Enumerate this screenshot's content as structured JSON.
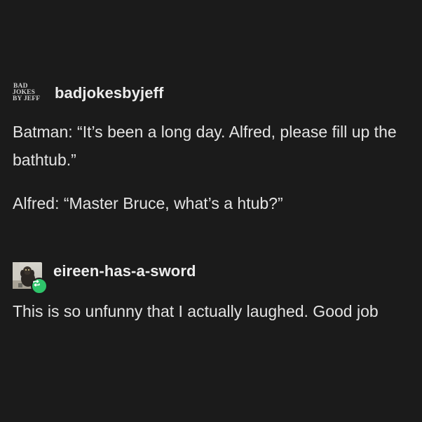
{
  "op": {
    "avatar_logo_lines": [
      "BAD",
      "JOKES",
      "BY JEFF"
    ],
    "username": "badjokesbyjeff",
    "paragraphs": [
      "Batman: “It’s been a long day. Alfred, please fill up the bathtub.”",
      "Alfred: “Master Bruce, what’s a htub?”"
    ]
  },
  "reblog": {
    "avatar_icon": "dog-photo-avatar",
    "badge_icon": "reblog-icon",
    "badge_color": "#2ec46a",
    "username": "eireen-has-a-sword",
    "text": "This is so unfunny that I actually laughed. Good job"
  },
  "colors": {
    "background": "#1b1b1b",
    "text": "#e4e4e4"
  }
}
